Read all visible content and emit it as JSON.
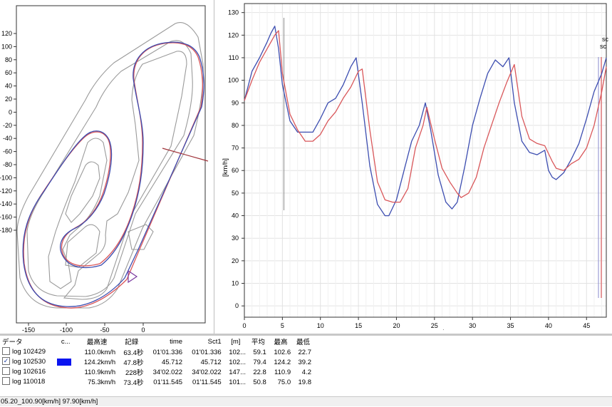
{
  "track_map": {
    "x_ticks": [
      "-150",
      "-100",
      "-50",
      "0"
    ],
    "y_ticks": [
      "120",
      "100",
      "80",
      "60",
      "40",
      "20",
      "0",
      "-20",
      "-40",
      "-60",
      "-80",
      "-100",
      "-120",
      "-140",
      "-160",
      "-180"
    ],
    "colors": {
      "blue_lap": "#3c4db0",
      "red_lap": "#d9575a",
      "track_outline": "#9a9a9a",
      "marker": "#a0333a"
    }
  },
  "speed_chart": {
    "y_unit": "[km/h]",
    "y_ticks": [
      "0",
      "10",
      "20",
      "30",
      "40",
      "50",
      "60",
      "70",
      "80",
      "90",
      "100",
      "110",
      "120",
      "130"
    ],
    "x_ticks": [
      "0",
      "5",
      "10",
      "15",
      "20",
      "25",
      "30",
      "35",
      "40",
      "45"
    ],
    "edge_labels": [
      "sc",
      "sc"
    ],
    "cursor_x": 5.2
  },
  "chart_data": {
    "type": "line",
    "ylabel": "[km/h]",
    "xlim": [
      0,
      47.6
    ],
    "ylim": [
      -5,
      134
    ],
    "series": [
      {
        "color": "#3c4db0",
        "x": [
          0,
          1,
          2,
          3,
          3.5,
          4,
          4.5,
          5,
          6,
          7,
          8,
          8.5,
          9,
          10,
          11,
          12,
          13,
          14,
          14.7,
          15.5,
          16.5,
          17.5,
          18.5,
          19,
          20,
          21,
          22,
          23,
          23.8,
          24.5,
          25.5,
          26.5,
          27.3,
          28,
          29,
          30,
          31,
          32,
          33,
          34,
          34.8,
          35.5,
          36.5,
          37.5,
          38.5,
          39.5,
          40,
          40.5,
          41,
          42,
          43,
          44,
          45,
          46,
          47,
          47.6
        ],
        "y": [
          91,
          104,
          110,
          117,
          121,
          124,
          114,
          98,
          82,
          77,
          77,
          77,
          77,
          83,
          90,
          92,
          98,
          106,
          110,
          90,
          62,
          45,
          40,
          40,
          47,
          60,
          73,
          80,
          90,
          78,
          58,
          46,
          43,
          46,
          62,
          80,
          92,
          103,
          109,
          106,
          110,
          90,
          73,
          68,
          67,
          69,
          60,
          57,
          56,
          59,
          65,
          72,
          83,
          95,
          103,
          110
        ]
      },
      {
        "color": "#d9575a",
        "x": [
          0,
          1,
          2,
          3,
          4,
          4.5,
          5,
          6,
          7,
          8,
          9,
          10,
          11,
          12,
          13,
          14,
          15,
          15.5,
          16.5,
          17.5,
          18.5,
          19.5,
          20.5,
          21.5,
          22.5,
          23.5,
          24,
          25,
          26,
          27,
          28,
          28.5,
          29.5,
          30.5,
          31.5,
          32.5,
          33.5,
          34.5,
          35.5,
          36.5,
          37.5,
          38.5,
          39.5,
          40.5,
          41,
          42,
          43,
          44,
          45,
          46,
          47,
          47.6
        ],
        "y": [
          91,
          100,
          108,
          114,
          120,
          122,
          103,
          85,
          78,
          73,
          73,
          76,
          82,
          86,
          92,
          97,
          104,
          105,
          78,
          55,
          47,
          46,
          46,
          52,
          70,
          80,
          88,
          74,
          61,
          55,
          50,
          48,
          50,
          57,
          70,
          80,
          90,
          99,
          107,
          84,
          74,
          72,
          71,
          64,
          61,
          60,
          63,
          65,
          70,
          80,
          95,
          106
        ]
      }
    ]
  },
  "log_table": {
    "headers": [
      "データ",
      "c...",
      "最高速",
      "記録",
      "time",
      "Sct1",
      "[m]",
      "平均",
      "最高",
      "最低"
    ],
    "rows": [
      {
        "checked": false,
        "name": "log 102429",
        "swatch": "",
        "max_speed": "110.0km/h",
        "record": "63.4秒",
        "time": "01'01.336",
        "sct1": "01'01.336",
        "m": "102...",
        "avg": "59.1",
        "max": "102.6",
        "min": "22.7"
      },
      {
        "checked": true,
        "name": "log 102530",
        "swatch": "#0a14f0",
        "max_speed": "124.2km/h",
        "record": "47.8秒",
        "time": "45.712",
        "sct1": "45.712",
        "m": "102...",
        "avg": "79.4",
        "max": "124.2",
        "min": "39.2"
      },
      {
        "checked": false,
        "name": "log 102616",
        "swatch": "",
        "max_speed": "110.9km/h",
        "record": "228秒",
        "time": "34'02.022",
        "sct1": "34'02.022",
        "m": "147...",
        "avg": "22.8",
        "max": "110.9",
        "min": "4.2"
      },
      {
        "checked": false,
        "name": "log 110018",
        "swatch": "",
        "max_speed": "75.3km/h",
        "record": "73.4秒",
        "time": "01'11.545",
        "sct1": "01'11.545",
        "m": "101...",
        "avg": "50.8",
        "max": "75.0",
        "min": "19.8"
      }
    ]
  },
  "status_bar": {
    "text": "05.20_100.90[km/h] 97.90[km/h]"
  }
}
